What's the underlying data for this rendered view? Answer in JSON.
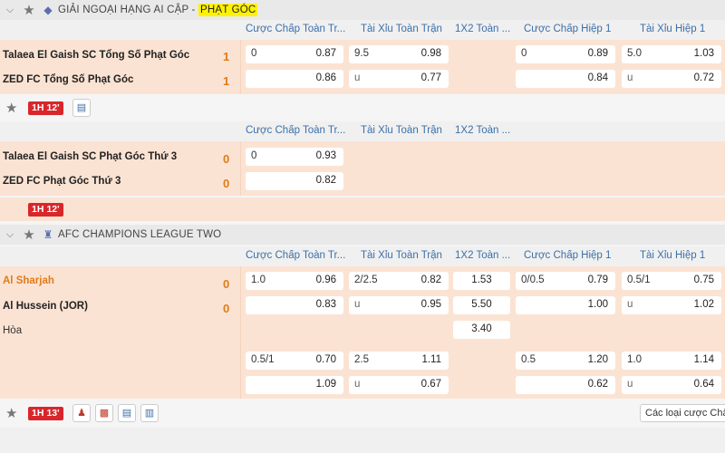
{
  "league1": {
    "name_prefix": "GIẢI NGOẠI HẠNG AI CẬP - ",
    "name_highlight": "PHẠT GÓC",
    "columns": [
      "Cược Chấp Toàn Tr...",
      "Tài Xỉu Toàn Trận",
      "1X2 Toàn ...",
      "Cược Chấp Hiệp 1",
      "Tài Xỉu Hiệp 1"
    ],
    "match1": {
      "home": "Talaea El Gaish SC Tổng Số Phạt Góc",
      "away": "ZED FC Tổng Số Phạt Góc",
      "home_score": "1",
      "away_score": "1",
      "ah_line": "0",
      "ah_home": "0.87",
      "ah_away": "0.86",
      "ou_line": "9.5",
      "ou_over": "0.98",
      "ou_under_label": "u",
      "ou_under": "0.77",
      "h1_ah_line": "0",
      "h1_ah_home": "0.89",
      "h1_ah_away": "0.84",
      "h1_ou_line": "5.0",
      "h1_ou_over": "1.03",
      "h1_ou_under_label": "u",
      "h1_ou_under": "0.72",
      "live_half": "1H",
      "live_min": "12'"
    },
    "match2": {
      "home": "Talaea El Gaish SC Phạt Góc Thứ 3",
      "away": "ZED FC Phạt Góc Thứ 3",
      "home_score": "0",
      "away_score": "0",
      "ah_line": "0",
      "ah_home": "0.93",
      "ah_away": "0.82",
      "live_half": "1H",
      "live_min": "12'"
    }
  },
  "league2": {
    "name": "AFC CHAMPIONS LEAGUE TWO",
    "columns": [
      "Cược Chấp Toàn Tr...",
      "Tài Xỉu Toàn Trận",
      "1X2 Toàn ...",
      "Cược Chấp Hiệp 1",
      "Tài Xỉu Hiệp 1"
    ],
    "match": {
      "home": "Al Sharjah",
      "away": "Al Hussein (JOR)",
      "draw_label": "Hòa",
      "home_score": "0",
      "away_score": "0",
      "row1": {
        "ah_line": "1.0",
        "ah_home": "0.96",
        "ah_away": "0.83",
        "ou_line": "2/2.5",
        "ou_over": "0.82",
        "ou_under_label": "u",
        "ou_under": "0.95",
        "x12_home": "1.53",
        "x12_away": "5.50",
        "x12_draw": "3.40",
        "h1_ah_line": "0/0.5",
        "h1_ah_home": "0.79",
        "h1_ah_away": "1.00",
        "h1_ou_line": "0.5/1",
        "h1_ou_over": "0.75",
        "h1_ou_under_label": "u",
        "h1_ou_under": "1.02"
      },
      "row2": {
        "ah_line": "0.5/1",
        "ah_home": "0.70",
        "ah_away": "1.09",
        "ou_line": "2.5",
        "ou_over": "1.11",
        "ou_under_label": "u",
        "ou_under": "0.67",
        "h1_ah_line": "0.5",
        "h1_ah_home": "1.20",
        "h1_ah_away": "0.62",
        "h1_ou_line": "1.0",
        "h1_ou_over": "1.14",
        "h1_ou_under_label": "u",
        "h1_ou_under": "0.64"
      },
      "live_half": "1H",
      "live_min": "13'",
      "more_label": "Các loại cược Châu"
    }
  },
  "icons": {
    "star": "★",
    "chevron": "⌵",
    "stats": "▤",
    "chart": "▥",
    "jersey": "▩",
    "trophy": "♜"
  }
}
